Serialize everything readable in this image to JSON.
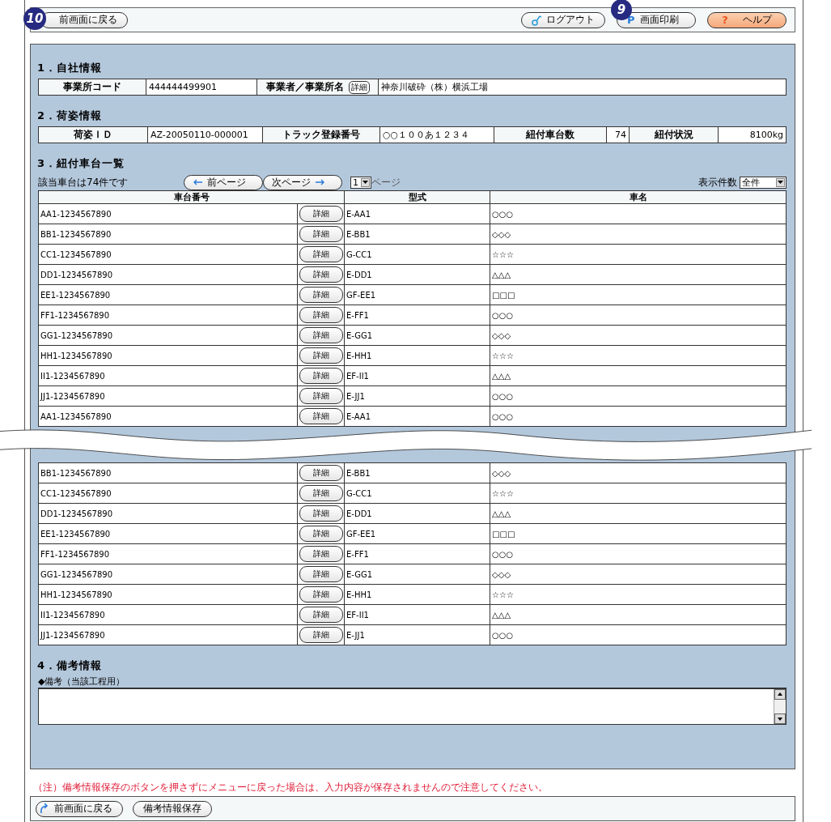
{
  "top_bar": {
    "back_button": "前画面に戻る",
    "logout_button": "ログアウト",
    "print_icon": "P",
    "print_button": "画面印刷",
    "help_icon": "?",
    "help_button": "ヘルプ"
  },
  "callouts": [
    "10",
    "9"
  ],
  "company": {
    "title": "1．自社情報",
    "office_code_label": "事業所コード",
    "office_code": "444444499901",
    "name_label": "事業者／事業所名",
    "detail_button": "詳細",
    "name": "神奈川破砕（株）横浜工場"
  },
  "package": {
    "title": "2．荷姿情報",
    "cells": [
      {
        "label": "荷姿ＩＤ",
        "value": "AZ-20050110-000001"
      },
      {
        "label": "トラック登録番号",
        "value": "○○１００あ１２３４"
      },
      {
        "label": "紐付車台数",
        "value": "74"
      },
      {
        "label": "紐付状況",
        "value": "8100kg"
      }
    ]
  },
  "vehicles": {
    "title": "3．紐付車台一覧",
    "count_text": "該当車台は74件です",
    "prev_button": "前ページ",
    "next_button": "次ページ",
    "page": "1",
    "page_label": "ページ",
    "per_page_label": "表示件数",
    "per_page": "全件",
    "columns": [
      "車台番号",
      "型式",
      "車名"
    ],
    "rows_before_break": [
      {
        "vehicle_no": "AA1-1234567890",
        "detail": "詳細",
        "model": "E-AA1",
        "name": "○○○"
      },
      {
        "vehicle_no": "BB1-1234567890",
        "detail": "詳細",
        "model": "E-BB1",
        "name": "◇◇◇"
      },
      {
        "vehicle_no": "CC1-1234567890",
        "detail": "詳細",
        "model": "G-CC1",
        "name": "☆☆☆"
      },
      {
        "vehicle_no": "DD1-1234567890",
        "detail": "詳細",
        "model": "E-DD1",
        "name": "△△△"
      },
      {
        "vehicle_no": "EE1-1234567890",
        "detail": "詳細",
        "model": "GF-EE1",
        "name": "□□□"
      },
      {
        "vehicle_no": "FF1-1234567890",
        "detail": "詳細",
        "model": "E-FF1",
        "name": "○○○"
      },
      {
        "vehicle_no": "GG1-1234567890",
        "detail": "詳細",
        "model": "E-GG1",
        "name": "◇◇◇"
      },
      {
        "vehicle_no": "HH1-1234567890",
        "detail": "詳細",
        "model": "E-HH1",
        "name": "☆☆☆"
      },
      {
        "vehicle_no": "II1-1234567890",
        "detail": "詳細",
        "model": "EF-II1",
        "name": "△△△"
      },
      {
        "vehicle_no": "JJ1-1234567890",
        "detail": "詳細",
        "model": "E-JJ1",
        "name": "○○○"
      },
      {
        "vehicle_no": "AA1-1234567890",
        "detail": "詳細",
        "model": "E-AA1",
        "name": "○○○"
      }
    ],
    "rows_after_break": [
      {
        "vehicle_no": "BB1-1234567890",
        "detail": "詳細",
        "model": "E-BB1",
        "name": "◇◇◇"
      },
      {
        "vehicle_no": "CC1-1234567890",
        "detail": "詳細",
        "model": "G-CC1",
        "name": "☆☆☆"
      },
      {
        "vehicle_no": "DD1-1234567890",
        "detail": "詳細",
        "model": "E-DD1",
        "name": "△△△"
      },
      {
        "vehicle_no": "EE1-1234567890",
        "detail": "詳細",
        "model": "GF-EE1",
        "name": "□□□"
      },
      {
        "vehicle_no": "FF1-1234567890",
        "detail": "詳細",
        "model": "E-FF1",
        "name": "○○○"
      },
      {
        "vehicle_no": "GG1-1234567890",
        "detail": "詳細",
        "model": "E-GG1",
        "name": "◇◇◇"
      },
      {
        "vehicle_no": "HH1-1234567890",
        "detail": "詳細",
        "model": "E-HH1",
        "name": "☆☆☆"
      },
      {
        "vehicle_no": "II1-1234567890",
        "detail": "詳細",
        "model": "EF-II1",
        "name": "△△△"
      },
      {
        "vehicle_no": "JJ1-1234567890",
        "detail": "詳細",
        "model": "E-JJ1",
        "name": "○○○"
      }
    ]
  },
  "remarks": {
    "title": "4．備考情報",
    "label": "◆備考（当該工程用）"
  },
  "note": "（注）備考情報保存のボタンを押さずにメニューに戻った場合は、入力内容が保存されませんので注意してください。",
  "bottom_bar": {
    "back_button": "前画面に戻る",
    "save_button": "備考情報保存"
  }
}
